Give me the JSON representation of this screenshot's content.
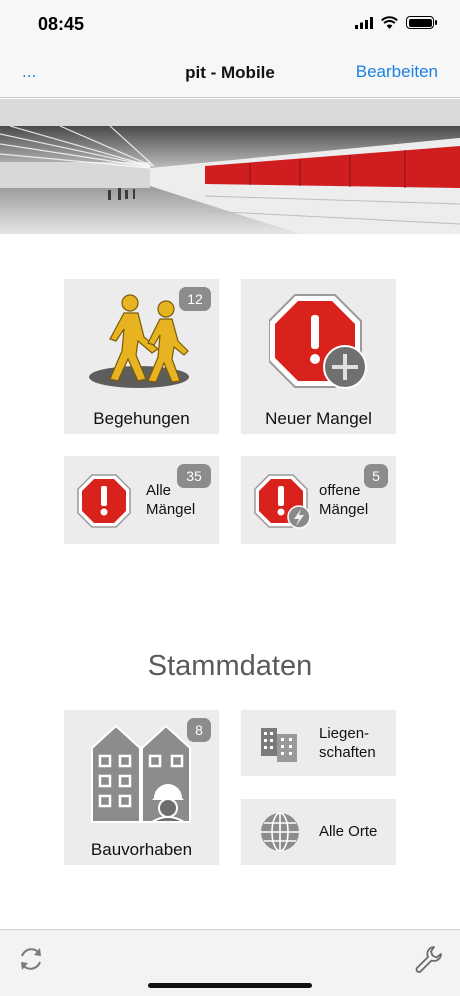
{
  "status_bar": {
    "time": "08:45"
  },
  "nav": {
    "left": "...",
    "title": "pit - Mobile",
    "right": "Bearbeiten"
  },
  "tiles": {
    "begehungen": {
      "label": "Begehungen",
      "badge": "12"
    },
    "neuer_mangel": {
      "label": "Neuer Mangel"
    },
    "alle_maengel": {
      "line1": "Alle",
      "line2": "Mängel",
      "badge": "35"
    },
    "offene_maengel": {
      "line1": "offene",
      "line2": "Mängel",
      "badge": "5"
    }
  },
  "stammdaten": {
    "title": "Stammdaten",
    "bauvorhaben": {
      "label": "Bauvorhaben",
      "badge": "8"
    },
    "liegenschaften": {
      "line1": "Liegen-",
      "line2": "schaften"
    },
    "alle_orte": {
      "label": "Alle Orte"
    }
  },
  "icons": {
    "walkers": "walkers-icon",
    "stop_plus": "stop-sign-plus-icon",
    "stop": "stop-sign-icon",
    "stop_lightning": "stop-sign-lightning-icon",
    "buildings": "buildings-icon",
    "office": "office-buildings-icon",
    "globe": "globe-icon",
    "sync": "sync-icon",
    "wrench": "wrench-icon"
  },
  "colors": {
    "accent": "#1a82e2",
    "alert_red": "#d9221c",
    "walker_yellow": "#e7b321",
    "badge": "#8c8c8c"
  }
}
